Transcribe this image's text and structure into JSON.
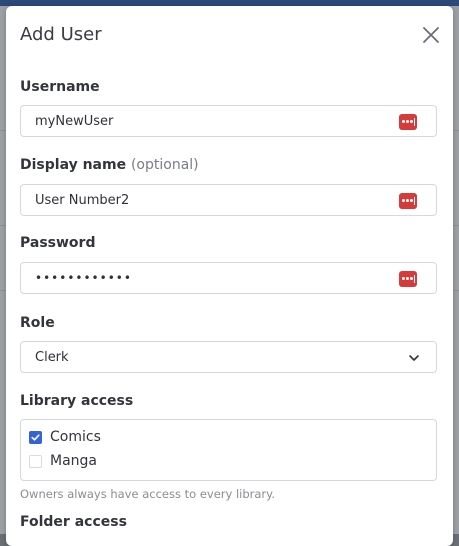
{
  "dialog": {
    "title": "Add User"
  },
  "fields": {
    "username": {
      "label": "Username",
      "value": "myNewUser"
    },
    "display_name": {
      "label": "Display name",
      "optional": "(optional)",
      "value": "User Number2"
    },
    "password": {
      "label": "Password",
      "value": "••••••••••••"
    },
    "role": {
      "label": "Role",
      "value": "Clerk"
    }
  },
  "library_access": {
    "label": "Library access",
    "items": [
      {
        "label": "Comics",
        "checked": true
      },
      {
        "label": "Manga",
        "checked": false
      }
    ],
    "help": "Owners always have access to every library."
  },
  "folder_access": {
    "label": "Folder access"
  },
  "colors": {
    "accent": "#3763d6",
    "password_manager": "#d63b3b"
  },
  "icons": {
    "close": "close-icon",
    "password_manager": "password-manager-icon",
    "chevron": "chevron-down-icon",
    "check": "checkmark-icon"
  }
}
